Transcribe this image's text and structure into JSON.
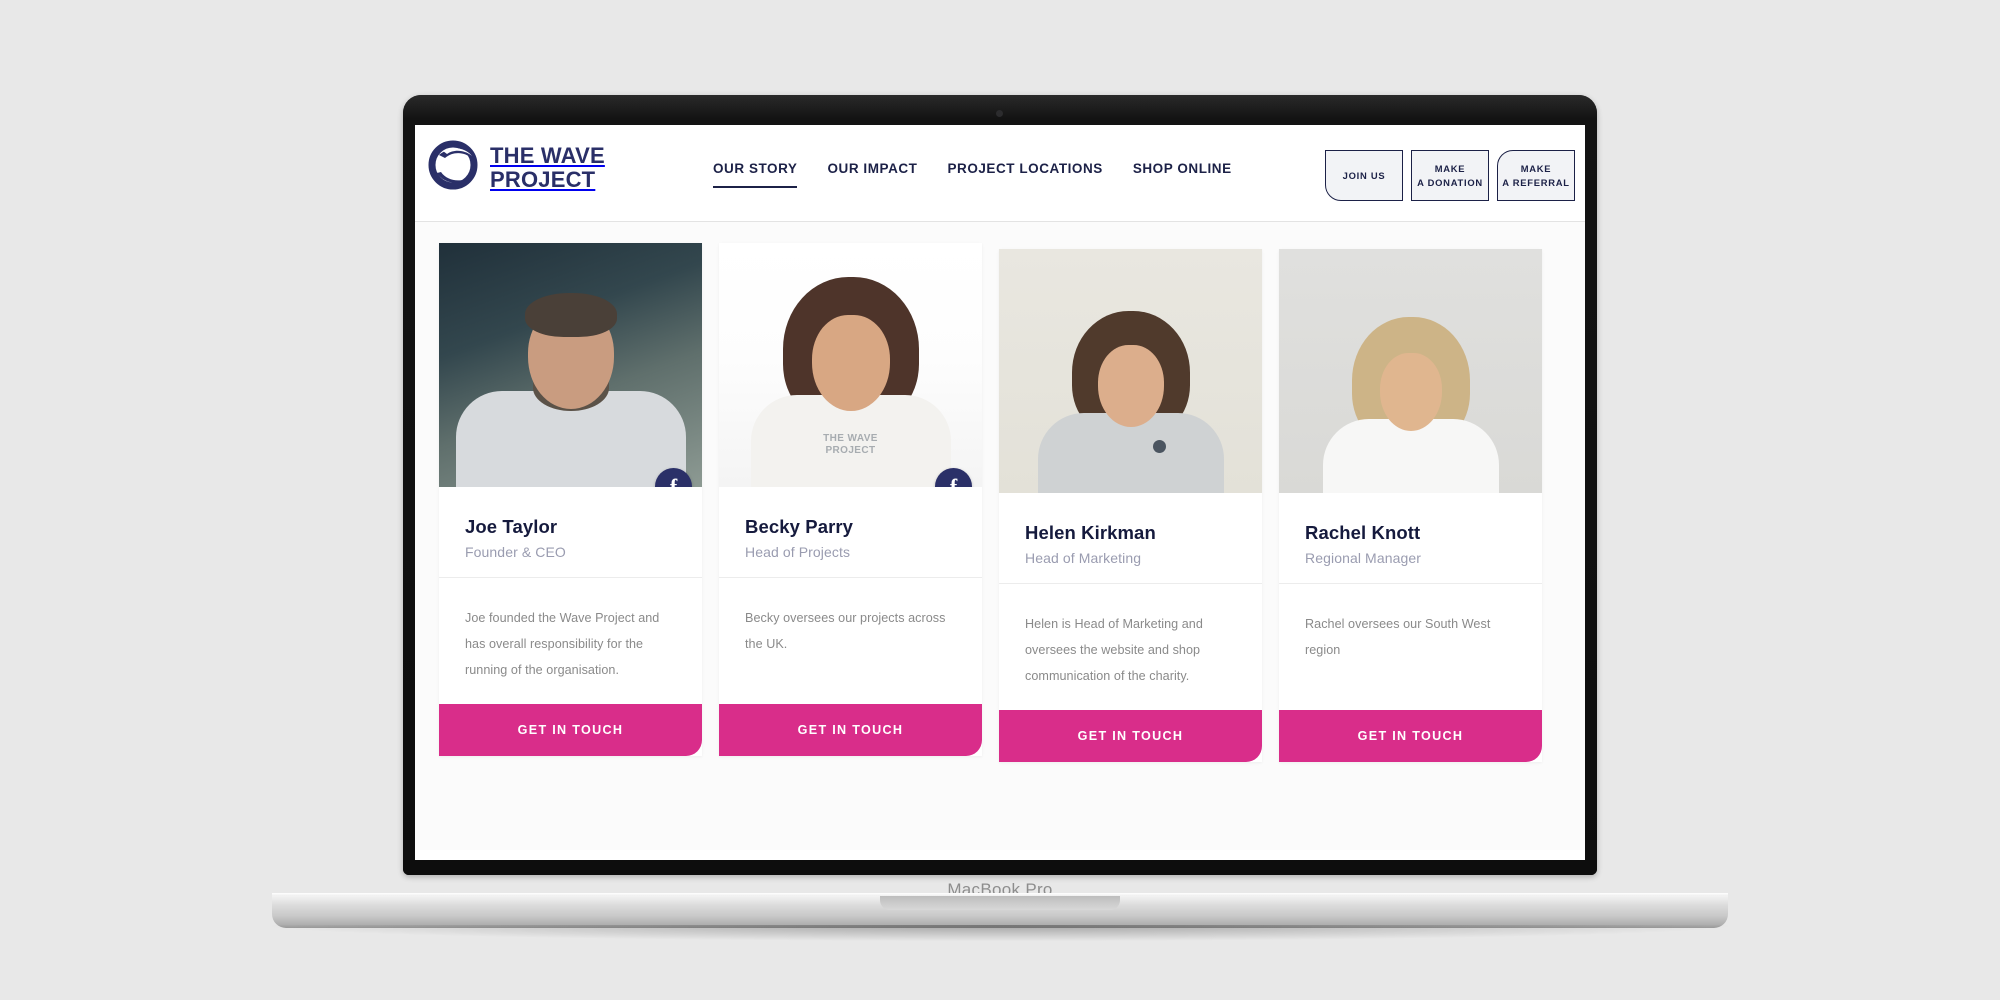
{
  "device": {
    "label": "MacBook Pro"
  },
  "header": {
    "brand": {
      "line1": "THE WAVE",
      "line2": "PROJECT",
      "logo_icon": "wave-circle-logo",
      "color": "#2a2f68"
    },
    "nav": [
      {
        "label": "OUR STORY",
        "active": true
      },
      {
        "label": "OUR IMPACT",
        "active": false
      },
      {
        "label": "PROJECT LOCATIONS",
        "active": false
      },
      {
        "label": "SHOP ONLINE",
        "active": false
      }
    ],
    "actions": [
      {
        "id": "join-us",
        "line1": "JOIN US",
        "line2": ""
      },
      {
        "id": "make-donation",
        "line1": "MAKE",
        "line2": "A DONATION"
      },
      {
        "id": "make-referral",
        "line1": "MAKE",
        "line2": "A REFERRAL"
      }
    ]
  },
  "team": {
    "cta_label": "GET IN TOUCH",
    "accent_color": "#d92d8a",
    "navy_color": "#151a3d",
    "members": [
      {
        "name": "Joe Taylor",
        "role": "Founder & CEO",
        "bio": "Joe founded the Wave Project and has overall responsibility for the running of the organisation.",
        "social": "facebook",
        "has_social": true
      },
      {
        "name": "Becky Parry",
        "role": "Head of Projects",
        "bio": "Becky oversees our projects across the UK.",
        "social": "facebook",
        "has_social": true,
        "shirt_text_line1": "THE WAVE",
        "shirt_text_line2": "PROJECT"
      },
      {
        "name": "Helen Kirkman",
        "role": "Head of Marketing",
        "bio": "Helen is Head of Marketing and oversees the website and shop communication of the charity.",
        "social": "",
        "has_social": false
      },
      {
        "name": "Rachel Knott",
        "role": "Regional Manager",
        "bio": "Rachel oversees our South West region",
        "social": "",
        "has_social": false
      }
    ]
  }
}
